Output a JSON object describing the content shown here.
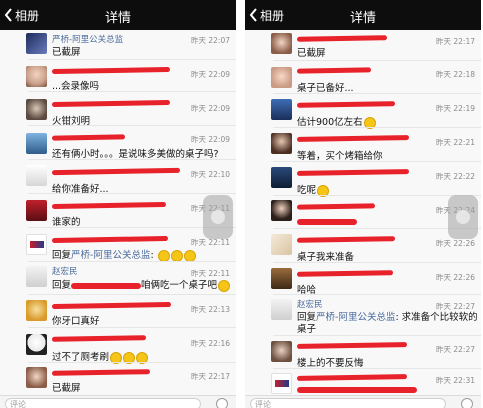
{
  "colors": {
    "navbar": "#0d0d0d",
    "link_name": "#4a6b9c",
    "redaction": "#e8222b",
    "time": "#8a8a8a"
  },
  "icons": {
    "back": "chevron-left-icon",
    "emoji": "smiley-icon"
  },
  "left": {
    "back_label": "相册",
    "title": "详情",
    "comment_placeholder": "评论",
    "rows": [
      {
        "name": "严桥-阿里公关总监",
        "time": "昨天 22:07",
        "text": "已截屏"
      },
      {
        "name": "",
        "time": "昨天 22:09",
        "text": "...会录像吗"
      },
      {
        "name": "",
        "time": "昨天 22:09",
        "text": "火钳刘明"
      },
      {
        "name": "",
        "time": "昨天 22:09",
        "text": "还有俩小时。。。是说味多美做的桌子吗?"
      },
      {
        "name": "",
        "time": "昨天 22:10",
        "text": "给你准备好..."
      },
      {
        "name": "",
        "time": "昨天 22:11",
        "text": "谁家的"
      },
      {
        "name": "",
        "time": "昨天 22:11",
        "text_prefix": "回复",
        "reply_to": "严桥-阿里公关总监",
        "text": ":"
      },
      {
        "name": "赵宏民",
        "time": "昨天 22:11",
        "text_prefix": "回复",
        "text": "咱俩吃一个桌子吧"
      },
      {
        "name": "",
        "time": "昨天 22:13",
        "text": "你牙口真好"
      },
      {
        "name": "",
        "time": "昨天 22:16",
        "text": "过不了厕考刷"
      },
      {
        "name": "",
        "time": "昨天 22:17",
        "text": "已截屏"
      }
    ]
  },
  "right": {
    "back_label": "相册",
    "title": "详情",
    "comment_placeholder": "评论",
    "rows": [
      {
        "name": "",
        "time": "昨天 22:17",
        "text": "已截屏"
      },
      {
        "name": "",
        "time": "昨天 22:18",
        "text": "桌子已备好..."
      },
      {
        "name": "",
        "time": "昨天 22:19",
        "text": "估计900亿左右"
      },
      {
        "name": "",
        "time": "昨天 22:21",
        "text": "等着，买个烤箱给你"
      },
      {
        "name": "",
        "time": "昨天 22:22",
        "text": "吃呢"
      },
      {
        "name": "",
        "time": "昨天 22:24",
        "text": ""
      },
      {
        "name": "",
        "time": "昨天 22:26",
        "text": "桌子我来准备"
      },
      {
        "name": "",
        "time": "昨天 22:26",
        "text": "哈哈"
      },
      {
        "name": "赵宏民",
        "time": "昨天 22:27",
        "text_prefix": "回复",
        "reply_to": "严桥-阿里公关总监",
        "text": ": 求准备个比较软的",
        "text2": "桌子"
      },
      {
        "name": "",
        "time": "昨天 22:27",
        "text": "楼上的不要反悔"
      },
      {
        "name": "",
        "time": "昨天 22:31",
        "text": ""
      }
    ]
  }
}
